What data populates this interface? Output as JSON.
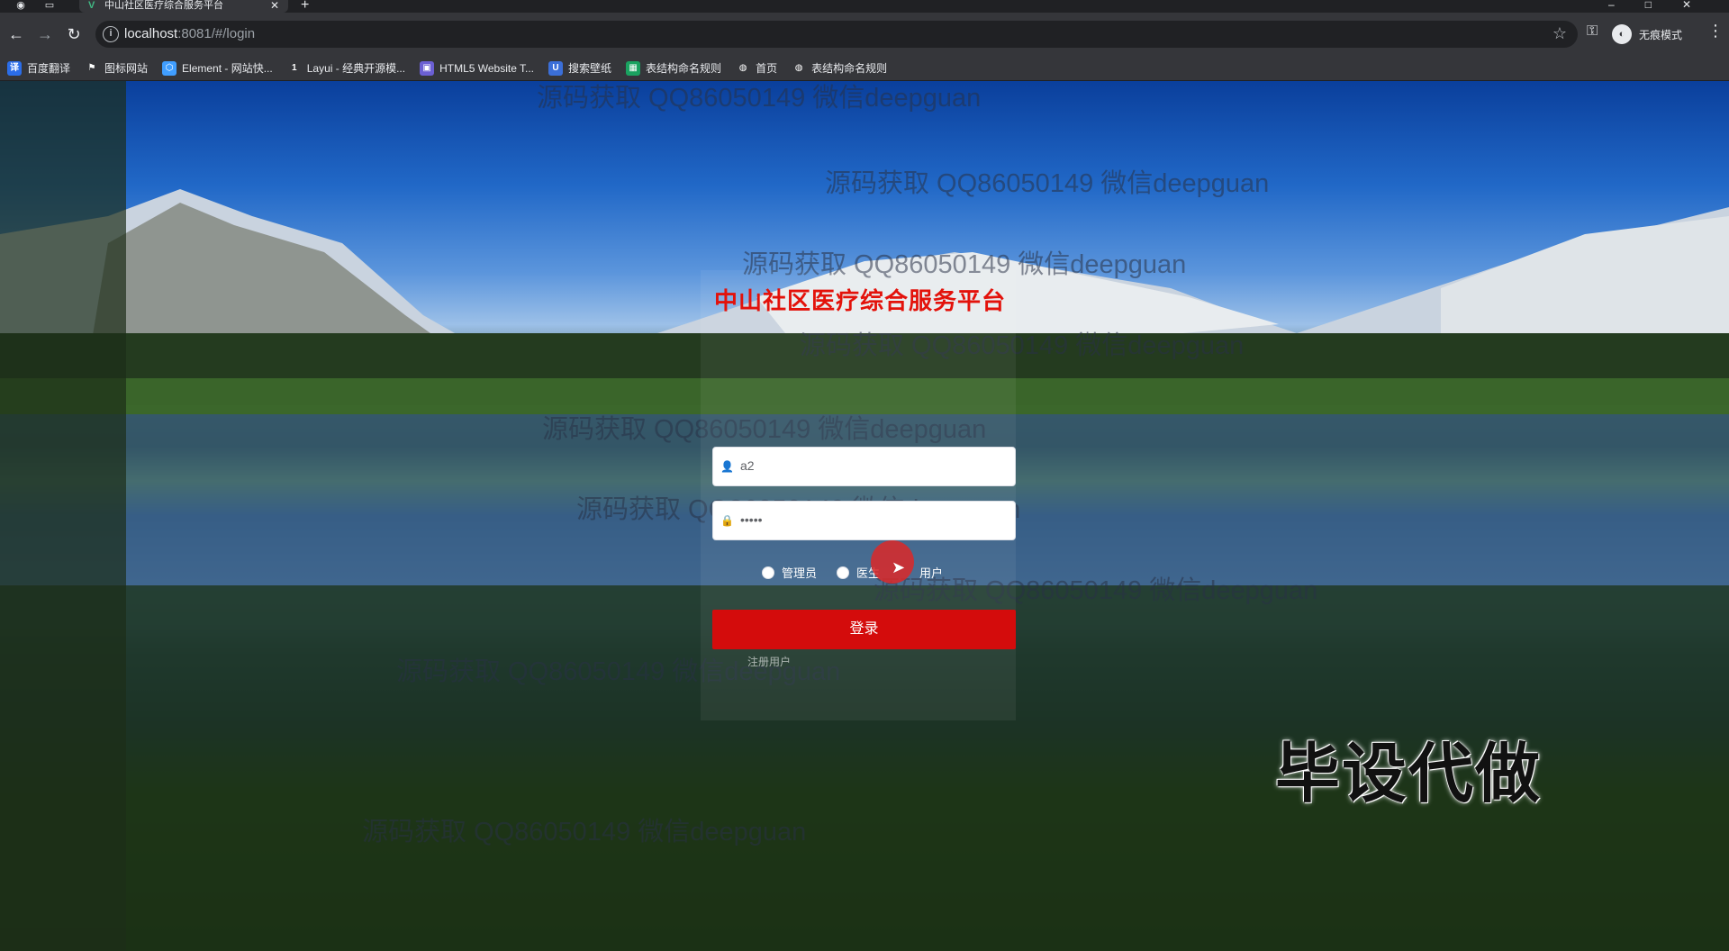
{
  "browser": {
    "tab_title": "中山社区医疗综合服务平台",
    "url_host": "localhost",
    "url_rest": ":8081/#/login",
    "incognito_label": "无痕模式"
  },
  "bookmarks": [
    {
      "label": "百度翻译",
      "icon": "translate-icon",
      "color": "#2b6de8"
    },
    {
      "label": "图标网站",
      "icon": "flag-icon",
      "color": "#35363a"
    },
    {
      "label": "Element - 网站快...",
      "icon": "element-icon",
      "color": "#409eff"
    },
    {
      "label": "Layui - 经典开源模...",
      "icon": "layui-icon",
      "color": "#35363a"
    },
    {
      "label": "HTML5 Website T...",
      "icon": "html5-icon",
      "color": "#6b5fd3"
    },
    {
      "label": "搜索壁纸",
      "icon": "wallpaper-icon",
      "color": "#3b6fd8"
    },
    {
      "label": "表结构命名规则",
      "icon": "sheet-icon",
      "color": "#1aa260"
    },
    {
      "label": "首页",
      "icon": "globe-icon",
      "color": "#35363a"
    },
    {
      "label": "表结构命名规则",
      "icon": "globe-icon",
      "color": "#35363a"
    }
  ],
  "watermark_text": "源码获取 QQ86050149 微信deepguan",
  "login": {
    "title": "中山社区医疗综合服务平台",
    "username_value": "a2",
    "password_value": "•••••",
    "roles": [
      "管理员",
      "医生",
      "用户"
    ],
    "submit_label": "登录",
    "register_label": "注册用户"
  },
  "promo_text": "毕设代做",
  "colors": {
    "brand_red": "#d40c0c",
    "title_red": "#e3120b"
  }
}
